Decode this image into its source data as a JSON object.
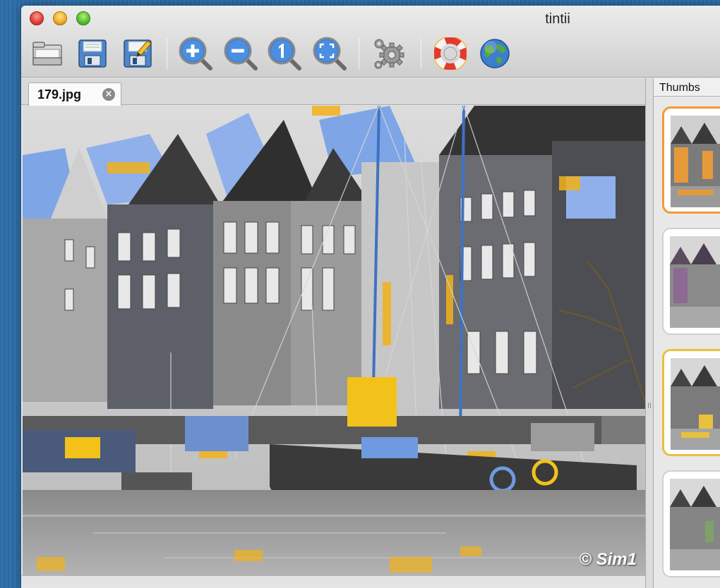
{
  "window": {
    "title": "tintii"
  },
  "toolbar": {
    "buttons": [
      {
        "name": "open-button",
        "icon": "folder-icon"
      },
      {
        "name": "save-button",
        "icon": "floppy-disk-icon"
      },
      {
        "name": "save-as-button",
        "icon": "floppy-edit-icon"
      },
      {
        "name": "zoom-in-button",
        "icon": "zoom-in-icon"
      },
      {
        "name": "zoom-out-button",
        "icon": "zoom-out-icon"
      },
      {
        "name": "zoom-actual-size-button",
        "icon": "zoom-1-icon"
      },
      {
        "name": "zoom-fit-button",
        "icon": "zoom-fit-icon"
      },
      {
        "name": "settings-button",
        "icon": "gears-icon"
      },
      {
        "name": "help-button",
        "icon": "lifebuoy-icon"
      },
      {
        "name": "website-button",
        "icon": "globe-icon"
      }
    ]
  },
  "tabs": [
    {
      "label": "179.jpg"
    }
  ],
  "image": {
    "watermark": "© Sim1"
  },
  "thumbs": {
    "header": "Thumbs",
    "items": [
      {
        "tint": "orange",
        "selected": true
      },
      {
        "tint": "purple",
        "selected": false
      },
      {
        "tint": "yellow",
        "selected": true
      },
      {
        "tint": "green",
        "selected": false
      }
    ]
  },
  "colors": {
    "accent_orange": "#f39a35",
    "accent_yellow": "#e8c13c",
    "sky_blue": "#7ea6e6",
    "tint_gold": "#f2b21a"
  }
}
